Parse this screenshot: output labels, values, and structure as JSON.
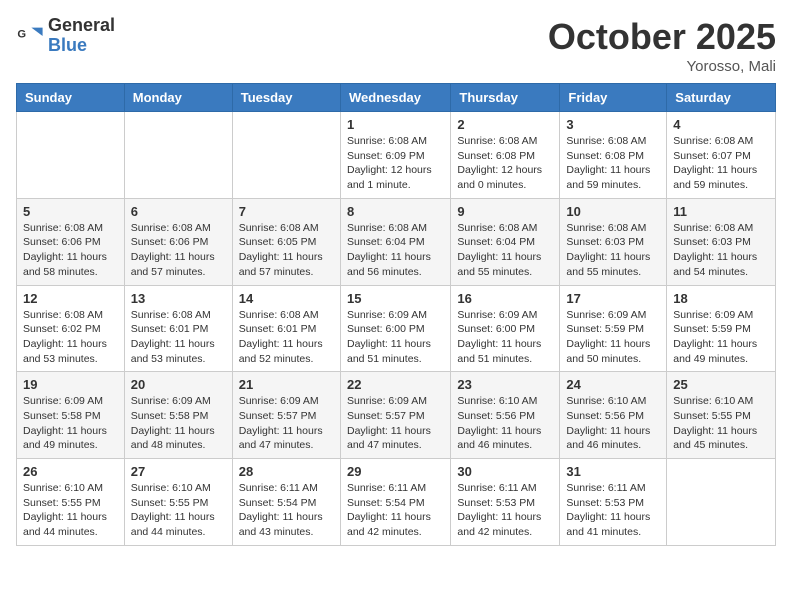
{
  "header": {
    "logo_general": "General",
    "logo_blue": "Blue",
    "month_title": "October 2025",
    "subtitle": "Yorosso, Mali"
  },
  "days_of_week": [
    "Sunday",
    "Monday",
    "Tuesday",
    "Wednesday",
    "Thursday",
    "Friday",
    "Saturday"
  ],
  "weeks": [
    [
      {
        "day": "",
        "info": ""
      },
      {
        "day": "",
        "info": ""
      },
      {
        "day": "",
        "info": ""
      },
      {
        "day": "1",
        "info": "Sunrise: 6:08 AM\nSunset: 6:09 PM\nDaylight: 12 hours\nand 1 minute."
      },
      {
        "day": "2",
        "info": "Sunrise: 6:08 AM\nSunset: 6:08 PM\nDaylight: 12 hours\nand 0 minutes."
      },
      {
        "day": "3",
        "info": "Sunrise: 6:08 AM\nSunset: 6:08 PM\nDaylight: 11 hours\nand 59 minutes."
      },
      {
        "day": "4",
        "info": "Sunrise: 6:08 AM\nSunset: 6:07 PM\nDaylight: 11 hours\nand 59 minutes."
      }
    ],
    [
      {
        "day": "5",
        "info": "Sunrise: 6:08 AM\nSunset: 6:06 PM\nDaylight: 11 hours\nand 58 minutes."
      },
      {
        "day": "6",
        "info": "Sunrise: 6:08 AM\nSunset: 6:06 PM\nDaylight: 11 hours\nand 57 minutes."
      },
      {
        "day": "7",
        "info": "Sunrise: 6:08 AM\nSunset: 6:05 PM\nDaylight: 11 hours\nand 57 minutes."
      },
      {
        "day": "8",
        "info": "Sunrise: 6:08 AM\nSunset: 6:04 PM\nDaylight: 11 hours\nand 56 minutes."
      },
      {
        "day": "9",
        "info": "Sunrise: 6:08 AM\nSunset: 6:04 PM\nDaylight: 11 hours\nand 55 minutes."
      },
      {
        "day": "10",
        "info": "Sunrise: 6:08 AM\nSunset: 6:03 PM\nDaylight: 11 hours\nand 55 minutes."
      },
      {
        "day": "11",
        "info": "Sunrise: 6:08 AM\nSunset: 6:03 PM\nDaylight: 11 hours\nand 54 minutes."
      }
    ],
    [
      {
        "day": "12",
        "info": "Sunrise: 6:08 AM\nSunset: 6:02 PM\nDaylight: 11 hours\nand 53 minutes."
      },
      {
        "day": "13",
        "info": "Sunrise: 6:08 AM\nSunset: 6:01 PM\nDaylight: 11 hours\nand 53 minutes."
      },
      {
        "day": "14",
        "info": "Sunrise: 6:08 AM\nSunset: 6:01 PM\nDaylight: 11 hours\nand 52 minutes."
      },
      {
        "day": "15",
        "info": "Sunrise: 6:09 AM\nSunset: 6:00 PM\nDaylight: 11 hours\nand 51 minutes."
      },
      {
        "day": "16",
        "info": "Sunrise: 6:09 AM\nSunset: 6:00 PM\nDaylight: 11 hours\nand 51 minutes."
      },
      {
        "day": "17",
        "info": "Sunrise: 6:09 AM\nSunset: 5:59 PM\nDaylight: 11 hours\nand 50 minutes."
      },
      {
        "day": "18",
        "info": "Sunrise: 6:09 AM\nSunset: 5:59 PM\nDaylight: 11 hours\nand 49 minutes."
      }
    ],
    [
      {
        "day": "19",
        "info": "Sunrise: 6:09 AM\nSunset: 5:58 PM\nDaylight: 11 hours\nand 49 minutes."
      },
      {
        "day": "20",
        "info": "Sunrise: 6:09 AM\nSunset: 5:58 PM\nDaylight: 11 hours\nand 48 minutes."
      },
      {
        "day": "21",
        "info": "Sunrise: 6:09 AM\nSunset: 5:57 PM\nDaylight: 11 hours\nand 47 minutes."
      },
      {
        "day": "22",
        "info": "Sunrise: 6:09 AM\nSunset: 5:57 PM\nDaylight: 11 hours\nand 47 minutes."
      },
      {
        "day": "23",
        "info": "Sunrise: 6:10 AM\nSunset: 5:56 PM\nDaylight: 11 hours\nand 46 minutes."
      },
      {
        "day": "24",
        "info": "Sunrise: 6:10 AM\nSunset: 5:56 PM\nDaylight: 11 hours\nand 46 minutes."
      },
      {
        "day": "25",
        "info": "Sunrise: 6:10 AM\nSunset: 5:55 PM\nDaylight: 11 hours\nand 45 minutes."
      }
    ],
    [
      {
        "day": "26",
        "info": "Sunrise: 6:10 AM\nSunset: 5:55 PM\nDaylight: 11 hours\nand 44 minutes."
      },
      {
        "day": "27",
        "info": "Sunrise: 6:10 AM\nSunset: 5:55 PM\nDaylight: 11 hours\nand 44 minutes."
      },
      {
        "day": "28",
        "info": "Sunrise: 6:11 AM\nSunset: 5:54 PM\nDaylight: 11 hours\nand 43 minutes."
      },
      {
        "day": "29",
        "info": "Sunrise: 6:11 AM\nSunset: 5:54 PM\nDaylight: 11 hours\nand 42 minutes."
      },
      {
        "day": "30",
        "info": "Sunrise: 6:11 AM\nSunset: 5:53 PM\nDaylight: 11 hours\nand 42 minutes."
      },
      {
        "day": "31",
        "info": "Sunrise: 6:11 AM\nSunset: 5:53 PM\nDaylight: 11 hours\nand 41 minutes."
      },
      {
        "day": "",
        "info": ""
      }
    ]
  ]
}
